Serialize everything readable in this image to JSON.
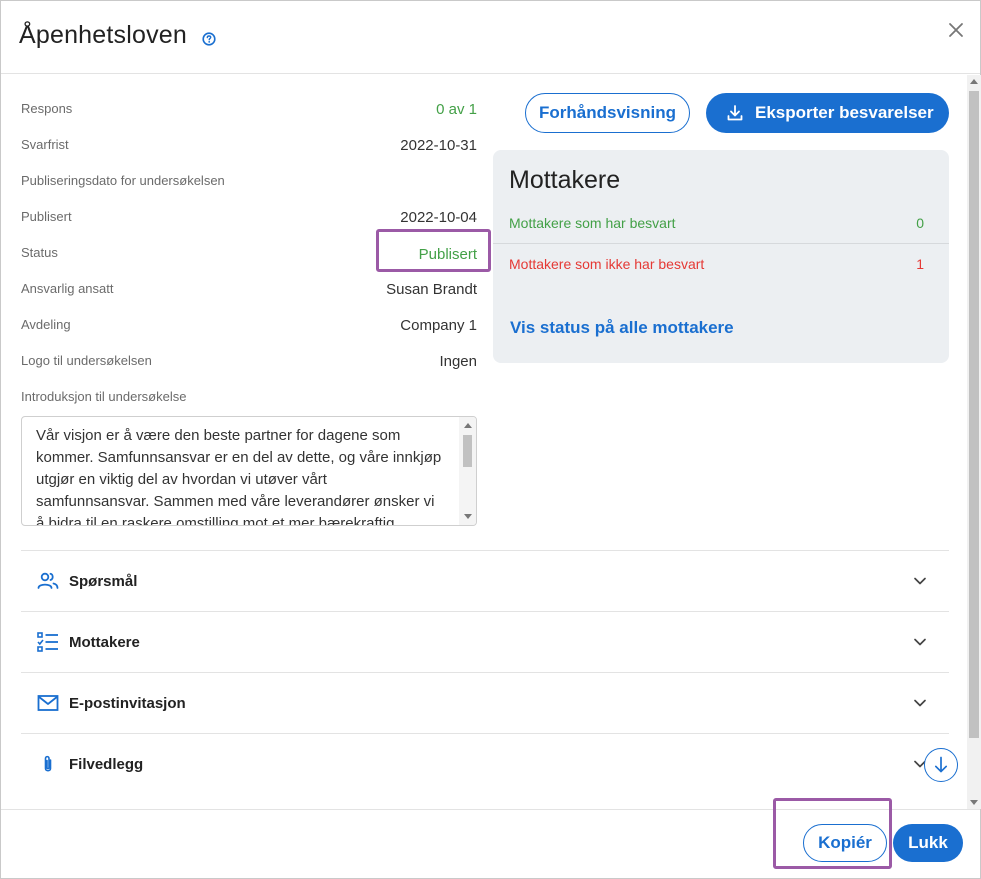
{
  "dialog": {
    "title": "Åpenhetsloven",
    "info": [
      {
        "label": "Respons",
        "value": "0 av 1",
        "value_color": "green"
      },
      {
        "label": "Svarfrist",
        "value": "2022-10-31"
      },
      {
        "label": "Publiseringsdato for undersøkelsen",
        "value": ""
      },
      {
        "label": "Publisert",
        "value": "2022-10-04"
      },
      {
        "label": "Status",
        "value": "Publisert",
        "value_color": "green"
      },
      {
        "label": "Ansvarlig ansatt",
        "value": "Susan Brandt"
      },
      {
        "label": "Avdeling",
        "value": "Company 1"
      },
      {
        "label": "Logo til undersøkelsen",
        "value": "Ingen"
      },
      {
        "label": "Introduksjon til undersøkelse",
        "value": ""
      }
    ],
    "intro_text": "Vår visjon er å være den beste partner for dagene som kommer. Samfunnsansvar er en del av dette, og våre innkjøp utgjør en viktig del av hvordan vi utøver vårt samfunnsansvar. Sammen med våre leverandører ønsker vi å bidra til en raskere omstilling mot et mer bærekraftig samfunn.",
    "buttons": {
      "preview": "Forhåndsvisning",
      "export": "Eksporter besvarelser"
    },
    "recipients_card": {
      "title": "Mottakere",
      "answered_label": "Mottakere som har besvart",
      "answered_count": "0",
      "not_answered_label": "Mottakere som ikke har besvart",
      "not_answered_count": "1",
      "status_link": "Vis status på alle mottakere"
    },
    "sections": [
      {
        "label": "Spørsmål",
        "icon": "people-icon"
      },
      {
        "label": "Mottakere",
        "icon": "checklist-icon"
      },
      {
        "label": "E-postinvitasjon",
        "icon": "mail-icon"
      },
      {
        "label": "Filvedlegg",
        "icon": "paperclip-icon"
      }
    ],
    "footer": {
      "copy": "Kopiér",
      "close": "Lukk"
    }
  },
  "colors": {
    "accent": "#1a6fd0",
    "green": "#43a047",
    "red": "#e53935",
    "highlight": "#9b5aa6"
  }
}
